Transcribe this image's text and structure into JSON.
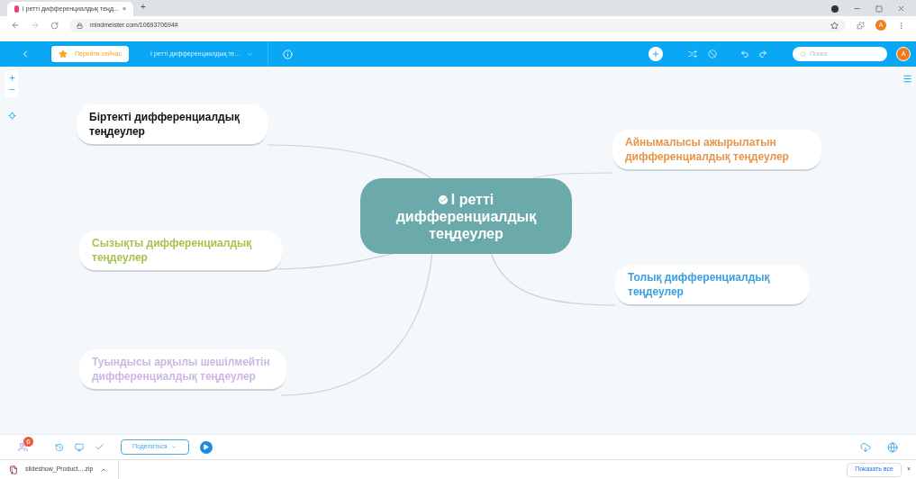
{
  "browser": {
    "tab_title": "I ретті дифференциалдық теңд...",
    "tab_close": "×",
    "new_tab": "+",
    "url": "mindmeister.com/1069370694#",
    "profile": "A"
  },
  "toolbar": {
    "upgrade": "Перейти сейчас",
    "map_title": "I ретті дифференциалдық те...",
    "search_placeholder": "Поиск",
    "avatar": "A"
  },
  "map": {
    "center": {
      "text": "I ретті дифференциалдық теңдеулер",
      "done": true
    },
    "topics": [
      {
        "text": "Біртекті дифференциалдық теңдеулер",
        "color": "#111111"
      },
      {
        "text": "Айнымалысы ажырылатын дифференциалдық теңдеулер",
        "color": "#e8944a"
      },
      {
        "text": "Сызықты дифференциалдық теңдеулер",
        "color": "#a9c24e"
      },
      {
        "text": "Толық дифференциалдық теңдеулер",
        "color": "#3b9fe2"
      },
      {
        "text": "Туындысы арқылы шешілмейтін дифференциалдық теңдеулер",
        "color": "#cbb7e3"
      }
    ]
  },
  "bottom_bar": {
    "badge": "6",
    "share": "Поделиться"
  },
  "downloads": {
    "file": "slideshow_Product....zip",
    "show_all": "Показать все",
    "close": "×"
  }
}
